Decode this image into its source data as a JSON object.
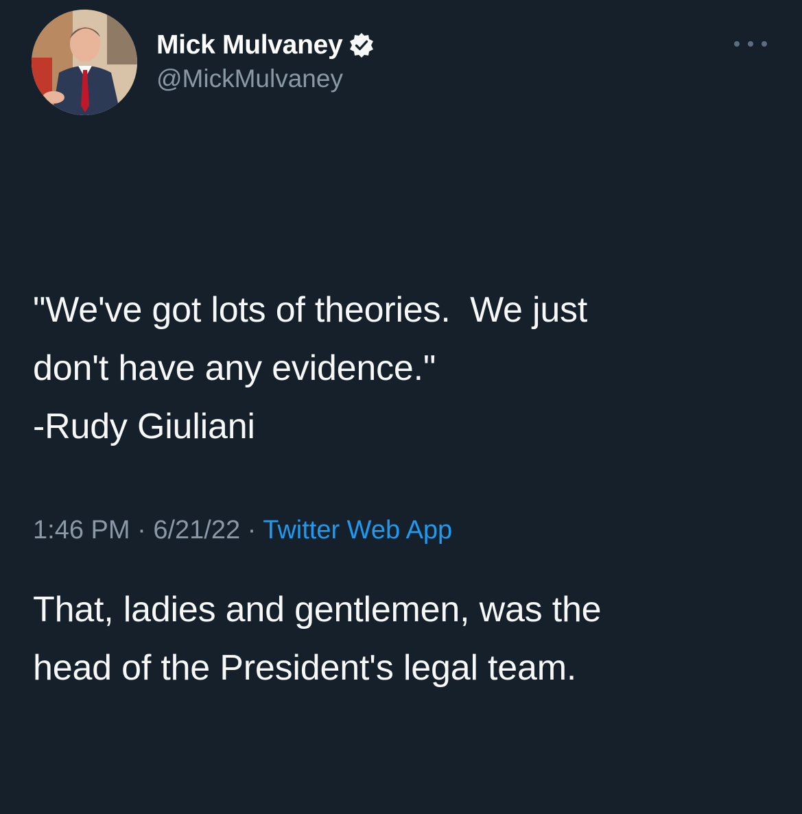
{
  "author": {
    "display_name": "Mick Mulvaney",
    "handle": "@MickMulvaney",
    "verified": true
  },
  "tweet": {
    "quote_line1": "\"We've got lots of theories.  We just",
    "quote_line2": "don't have any evidence.\"",
    "attribution": "-Rudy Giuliani",
    "comment_line1": "That, ladies and gentlemen, was the",
    "comment_line2": "head of the President's legal team."
  },
  "meta": {
    "time": "1:46 PM",
    "separator": "·",
    "date": "6/21/22",
    "source": "Twitter Web App"
  },
  "icons": {
    "verified": "verified-badge-icon",
    "more": "more-options-icon"
  },
  "colors": {
    "background": "#15202b",
    "text": "#f7f9f9",
    "secondary": "#8b98a5",
    "link": "#1d9bf0"
  }
}
